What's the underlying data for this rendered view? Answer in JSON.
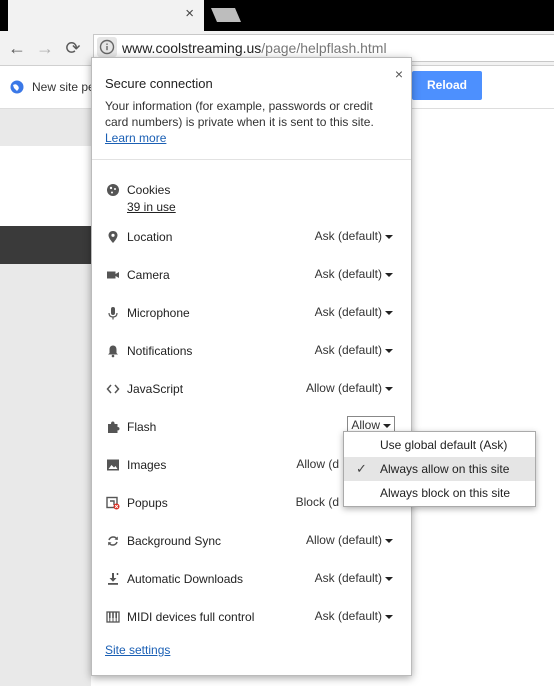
{
  "browser": {
    "tab_close_glyph": "×",
    "nav": {
      "back_glyph": "←",
      "forward_glyph": "→",
      "reload_glyph": "⟳"
    },
    "url": {
      "host": "www.coolstreaming.us",
      "path": "/page/helpflash.html"
    }
  },
  "infobar": {
    "text": "New site pe",
    "reload_label": "Reload"
  },
  "popup": {
    "close_glyph": "×",
    "secure_title": "Secure connection",
    "secure_text": "Your information (for example, passwords or credit card numbers) is private when it is sent to this site.",
    "learn_more": "Learn more",
    "cookies": {
      "label": "Cookies",
      "in_use": "39 in use"
    },
    "permissions": [
      {
        "label": "Location",
        "value": "Ask (default)"
      },
      {
        "label": "Camera",
        "value": "Ask (default)"
      },
      {
        "label": "Microphone",
        "value": "Ask (default)"
      },
      {
        "label": "Notifications",
        "value": "Ask (default)"
      },
      {
        "label": "JavaScript",
        "value": "Allow (default)"
      },
      {
        "label": "Flash",
        "value": "Allow"
      },
      {
        "label": "Images",
        "value": "Allow (d"
      },
      {
        "label": "Popups",
        "value": "Block (d"
      },
      {
        "label": "Background Sync",
        "value": "Allow (default)"
      },
      {
        "label": "Automatic Downloads",
        "value": "Ask (default)"
      },
      {
        "label": "MIDI devices full control",
        "value": "Ask (default)"
      }
    ],
    "site_settings": "Site settings"
  },
  "flash_dropdown": {
    "options": [
      {
        "label": "Use global default (Ask)"
      },
      {
        "label": "Always allow on this site"
      },
      {
        "label": "Always block on this site"
      }
    ],
    "check_glyph": "✓"
  },
  "colors": {
    "accent": "#4d90fe",
    "link": "#1a5fb4"
  }
}
